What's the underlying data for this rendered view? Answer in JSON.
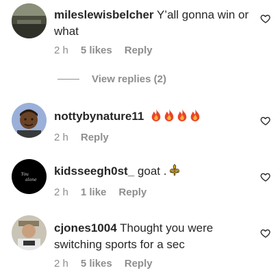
{
  "comments": [
    {
      "username": "mileslewisbelcher",
      "text": "Y’all gonna win or what",
      "time": "2 h",
      "likes": "5 likes",
      "reply_label": "Reply"
    },
    {
      "username": "nottybynature11",
      "text": "",
      "emoji": [
        "fire",
        "fire",
        "fire",
        "fire"
      ],
      "time": "2 h",
      "reply_label": "Reply"
    },
    {
      "username": "kidsseegh0st_",
      "text": "goat .",
      "emoji": [
        "fleur-de-lis"
      ],
      "time": "2 h",
      "likes": "1 like",
      "reply_label": "Reply"
    },
    {
      "username": "cjones1004",
      "text": "Thought you were switching sports for a sec",
      "time": "2 h",
      "likes": "5 likes",
      "reply_label": "Reply"
    }
  ],
  "view_replies_label": "View replies (2)",
  "icons": {
    "like": "heart-outline-icon",
    "emoji_fire": "fire-emoji-icon",
    "emoji_fleur": "fleur-de-lis-emoji-icon"
  },
  "colors": {
    "text": "#262626",
    "secondary": "#8e8e8e",
    "fire_red": "#e8452c",
    "fire_orange": "#ffb22e",
    "fleur_gold": "#d4a017"
  }
}
